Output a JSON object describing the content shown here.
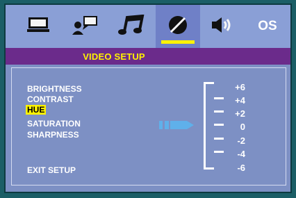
{
  "header": {
    "tabs": [
      {
        "name": "monitor-icon"
      },
      {
        "name": "speaker-person-icon"
      },
      {
        "name": "music-note-icon"
      },
      {
        "name": "video-disc-icon",
        "active": true
      },
      {
        "name": "speaker-volume-icon"
      },
      {
        "label": "OS"
      }
    ]
  },
  "video_setup": {
    "title": "VIDEO SETUP",
    "items": [
      {
        "label": "BRIGHTNESS"
      },
      {
        "label": "CONTRAST"
      },
      {
        "label": "HUE",
        "selected": true
      },
      {
        "label": "SATURATION"
      },
      {
        "label": "SHARPNESS"
      }
    ],
    "exit_label": "EXIT SETUP"
  },
  "scale": {
    "labels": [
      "+6",
      "+4",
      "+2",
      "0",
      "-2",
      "-4",
      "-6"
    ],
    "current_value": "0"
  },
  "colors": {
    "background": "#1b5e66",
    "panel": "#7d90c4",
    "tabbar": "#8a9fd6",
    "subbar": "#6b2b8b",
    "accent": "#fff200",
    "pointer": "#5fb0ea"
  }
}
